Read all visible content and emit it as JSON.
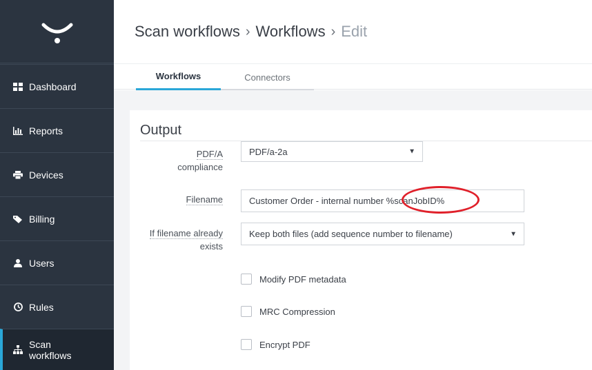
{
  "breadcrumb": {
    "item1": "Scan workflows",
    "sep": "›",
    "item2": "Workflows",
    "item3": "Edit"
  },
  "sidebar": {
    "items": [
      {
        "label": "Dashboard",
        "icon": "dashboard-icon"
      },
      {
        "label": "Reports",
        "icon": "bar-chart-icon"
      },
      {
        "label": "Devices",
        "icon": "printer-icon"
      },
      {
        "label": "Billing",
        "icon": "tag-icon"
      },
      {
        "label": "Users",
        "icon": "user-icon"
      },
      {
        "label": "Rules",
        "icon": "clock-icon"
      },
      {
        "label_line1": "Scan",
        "label_line2": "workflows",
        "icon": "sitemap-icon"
      }
    ]
  },
  "tabs": [
    {
      "label": "Workflows",
      "active": true
    },
    {
      "label": "Connectors",
      "active": false
    }
  ],
  "section": {
    "title": "Output"
  },
  "form": {
    "pdfa_label_line1": "PDF/A",
    "pdfa_label_line2": "compliance",
    "pdfa_value": "PDF/a-2a",
    "filename_label": "Filename",
    "filename_value": "Customer Order - internal number %scanJobID%",
    "exists_label_line1": "If filename already",
    "exists_label_line2": "exists",
    "exists_value": "Keep both files (add sequence number to filename)"
  },
  "checkboxes": [
    {
      "label": "Modify PDF metadata",
      "checked": false
    },
    {
      "label": "MRC Compression",
      "checked": false
    },
    {
      "label": "Encrypt PDF",
      "checked": false
    }
  ],
  "colors": {
    "sidebar_bg": "#2b3440",
    "accent": "#2aa7d8",
    "annotation": "#e0202a"
  }
}
